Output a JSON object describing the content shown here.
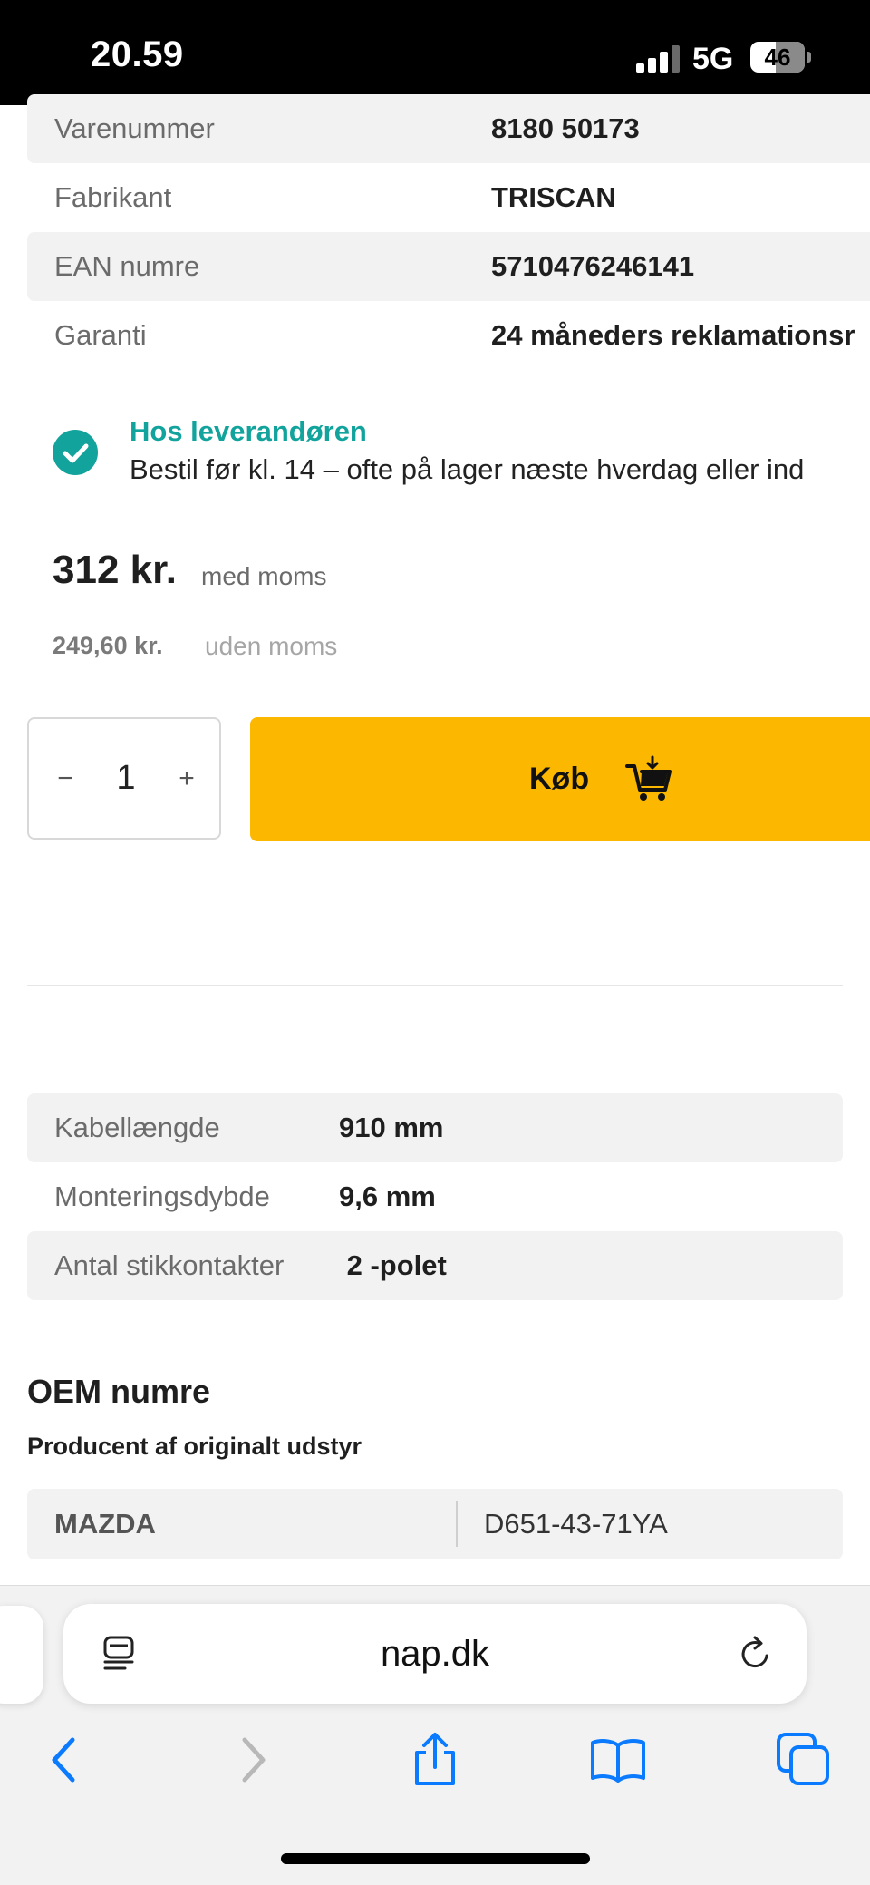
{
  "status_bar": {
    "time": "20.59",
    "network": "5G",
    "battery": "46",
    "battery_level": 0.46
  },
  "specs": [
    {
      "label": "Varenummer",
      "value": "8180 50173"
    },
    {
      "label": "Fabrikant",
      "value": "TRISCAN"
    },
    {
      "label": "EAN numre",
      "value": "5710476246141"
    },
    {
      "label": "Garanti",
      "value": "24 måneders reklamationsr"
    }
  ],
  "availability": {
    "title": "Hos leverandøren",
    "text": "Bestil før kl. 14 – ofte på lager næste hverdag eller ind"
  },
  "price": {
    "incl": "312 kr.",
    "incl_label": "med moms",
    "excl": "249,60 kr.",
    "excl_label": "uden moms"
  },
  "quantity": {
    "minus": "−",
    "value": "1",
    "plus": "+"
  },
  "buy_button": {
    "label": "Køb",
    "icon": "cart-icon",
    "color": "#fcb800"
  },
  "attributes": [
    {
      "label": "Kabellængde",
      "value": "910 mm"
    },
    {
      "label": "Monteringsdybde",
      "value": "9,6 mm"
    },
    {
      "label": "Antal stikkontakter",
      "value": " 2 -polet"
    }
  ],
  "oem": {
    "title": "OEM numre",
    "subtitle": "Producent af originalt udstyr",
    "rows": [
      {
        "brand": "MAZDA",
        "number": "D651-43-71YA"
      }
    ]
  },
  "browser": {
    "url": "nap.dk",
    "icons": [
      "reader-icon",
      "reload-icon",
      "back-icon",
      "forward-icon",
      "share-icon",
      "bookmarks-icon",
      "tabs-icon"
    ],
    "accent": "#0a7aff"
  },
  "colors": {
    "availability": "#11a39c"
  }
}
